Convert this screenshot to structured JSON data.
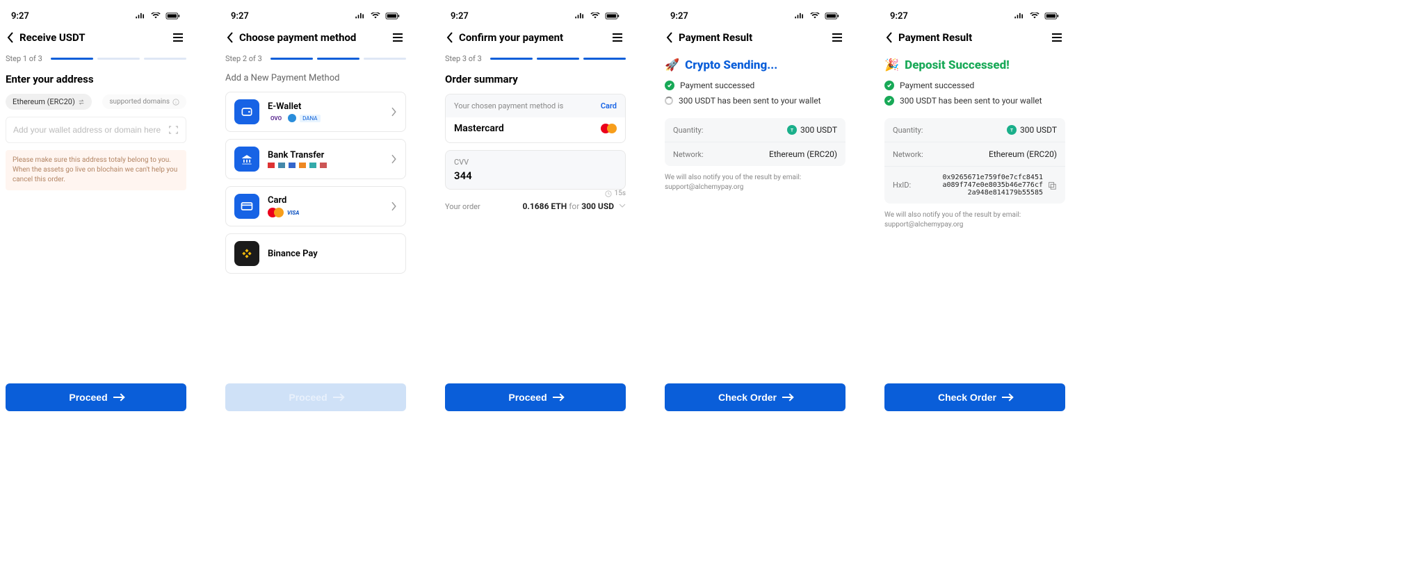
{
  "status_time": "9:27",
  "screens": [
    {
      "title": "Receive USDT",
      "step_label": "Step 1 of 3",
      "active_steps": 1,
      "section_title": "Enter your address",
      "chain_chip": "Ethereum (ERC20)",
      "supported_chip": "supported domains",
      "input_placeholder": "Add your wallet address or domain here",
      "warning": "Please make sure this address totaly belong to you. When the assets go live on blochain we can't help you cancel this order.",
      "button": "Proceed",
      "button_enabled": true
    },
    {
      "title": "Choose payment method",
      "step_label": "Step 2 of 3",
      "active_steps": 2,
      "section_sub": "Add a New Payment Method",
      "methods": [
        {
          "name": "E-Wallet",
          "icon": "ewallet",
          "logos": [
            "OVO",
            "gopay",
            "DANA"
          ]
        },
        {
          "name": "Bank Transfer",
          "icon": "bank",
          "logos": [
            "b1",
            "b2",
            "b3",
            "b4",
            "b5",
            "b6"
          ]
        },
        {
          "name": "Card",
          "icon": "card",
          "logos": [
            "mastercard",
            "visa"
          ]
        },
        {
          "name": "Binance Pay",
          "icon": "binance",
          "logos": []
        }
      ],
      "button": "Proceed",
      "button_enabled": false
    },
    {
      "title": "Confirm your payment",
      "step_label": "Step 3 of 3",
      "active_steps": 3,
      "section_title": "Order summary",
      "chosen_label": "Your chosen payment method is",
      "chosen_link": "Card",
      "chosen_value": "Mastercard",
      "cvv_label": "CVV",
      "cvv_value": "344",
      "timer": "15s",
      "your_order_label": "Your order",
      "order_eth": "0.1686 ETH",
      "order_for": "for",
      "order_usd": "300 USD",
      "button": "Proceed",
      "button_enabled": true
    },
    {
      "title": "Payment Result",
      "result_title": "Crypto Sending...",
      "result_color": "blue",
      "result_icon": "🚀",
      "status1": "Payment successed",
      "status1_done": true,
      "status2": "300 USDT has been sent to your wallet",
      "status2_done": false,
      "qty_label": "Quantity:",
      "qty_value": "300 USDT",
      "net_label": "Network:",
      "net_value": "Ethereum (ERC20)",
      "notify1": "We will also notify you of the result by email:",
      "notify2": "support@alchemypay.org",
      "button": "Check Order",
      "button_enabled": true
    },
    {
      "title": "Payment Result",
      "result_title": "Deposit Successed!",
      "result_color": "green",
      "result_icon": "🎉",
      "status1": "Payment successed",
      "status1_done": true,
      "status2": "300 USDT has been sent to your wallet",
      "status2_done": true,
      "qty_label": "Quantity:",
      "qty_value": "300 USDT",
      "net_label": "Network:",
      "net_value": "Ethereum (ERC20)",
      "hxid_label": "HxID:",
      "hxid_value": "0x9265671e759f0e7cfc8451a089f747e0e8035b46e776cf2a948e814179b55585",
      "notify1": "We will also notify you of the result by email:",
      "notify2": "support@alchemypay.org",
      "button": "Check Order",
      "button_enabled": true
    }
  ]
}
